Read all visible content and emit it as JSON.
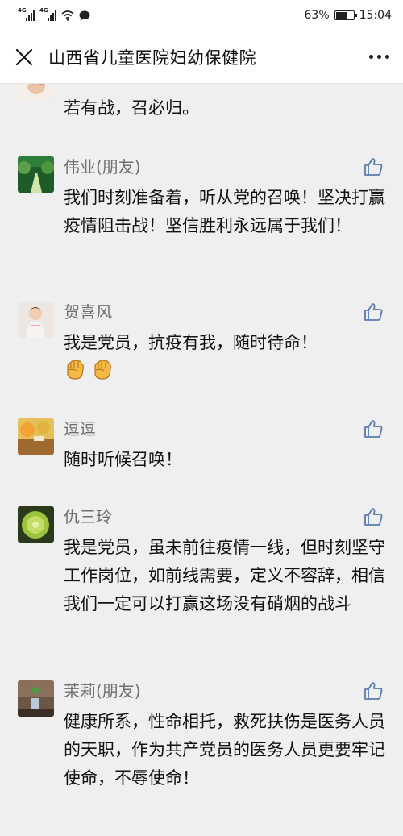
{
  "status_bar": {
    "signal1": "4G",
    "signal2": "4G",
    "battery_percent": "63%",
    "battery_level": 0.63,
    "time": "15:04"
  },
  "header": {
    "title": "山西省儿童医院妇幼保健院",
    "close_icon": "close-icon",
    "more_icon": "more-icon"
  },
  "comments": [
    {
      "name": "",
      "text": "若有战，召必归。"
    },
    {
      "name": "伟业(朋友)",
      "text": "我们时刻准备着，听从党的召唤！坚决打赢疫情阻击战！坚信胜利永远属于我们！"
    },
    {
      "name": "贺喜风",
      "text": "我是党员，抗疫有我，随时待命！",
      "emojis": [
        "fist-icon",
        "fist-icon"
      ]
    },
    {
      "name": "逗逗",
      "text": "随时听候召唤！"
    },
    {
      "name": "仇三玲",
      "text": "我是党员，虽未前往疫情一线，但时刻坚守工作岗位，如前线需要，定义不容辞，相信我们一定可以打赢这场没有硝烟的战斗"
    },
    {
      "name": "茉莉(朋友)",
      "text": "健康所系，性命相托，救死扶伤是医务人员的天职，作为共产党员的医务人员更要牢记使命，不辱使命！"
    }
  ],
  "colors": {
    "background": "#efefef",
    "name_gray": "#6f6f6f",
    "like_blue": "#5b7bb3",
    "fist_orange": "#f4b844"
  }
}
